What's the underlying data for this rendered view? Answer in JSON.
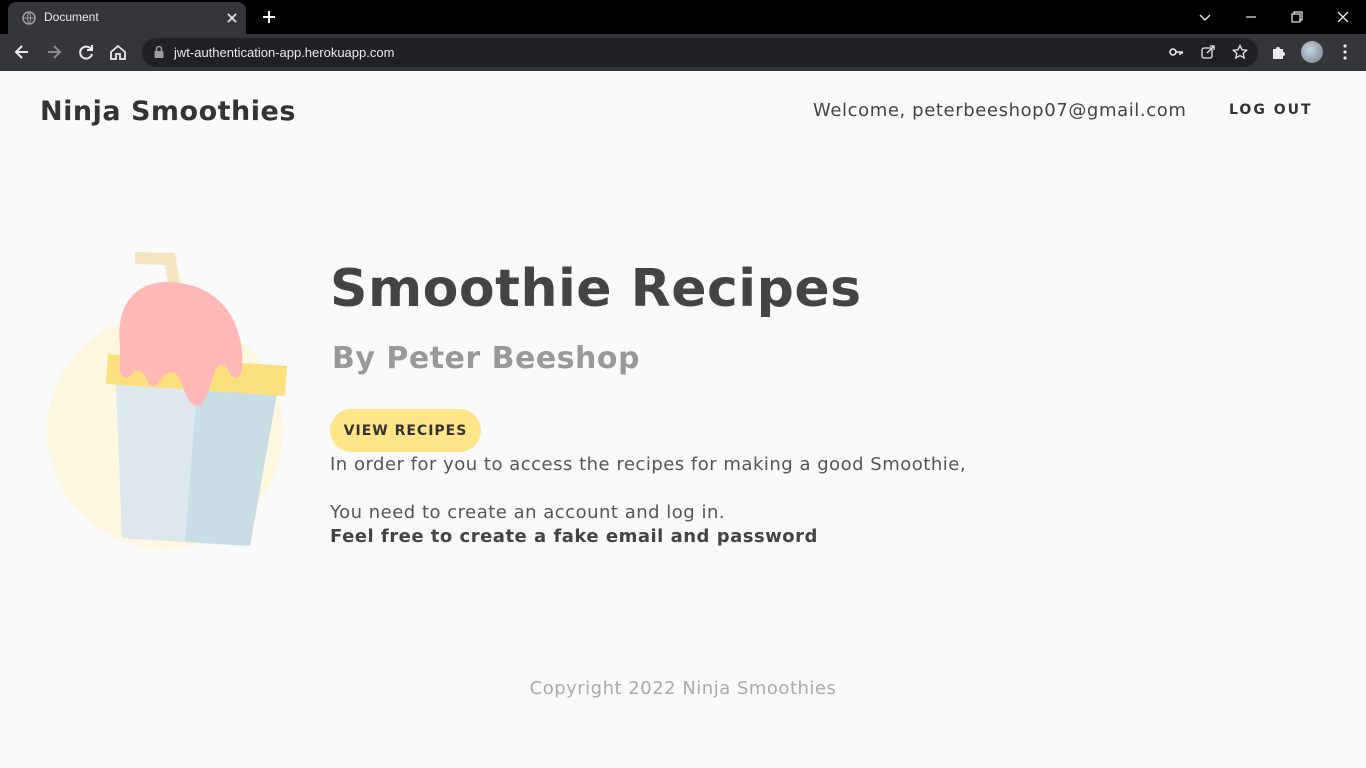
{
  "browser": {
    "tab_title": "Document",
    "url": "jwt-authentication-app.herokuapp.com"
  },
  "header": {
    "brand": "Ninja Smoothies",
    "welcome_text": "Welcome, peterbeeshop07@gmail.com",
    "logout_label": "LOG OUT"
  },
  "hero": {
    "title": "Smoothie Recipes",
    "subtitle": "By Peter Beeshop",
    "button_label": "VIEW RECIPES",
    "line1": "In order for you to access the recipes for making a good Smoothie,",
    "line2": "You need to create an account and log in.",
    "line3": "Feel free to create a fake email and password"
  },
  "footer": {
    "copyright": "Copyright 2022 Ninja Smoothies"
  },
  "colors": {
    "button_bg": "#fee587",
    "page_bg": "#fafafa",
    "chrome_bg": "#35363a"
  }
}
